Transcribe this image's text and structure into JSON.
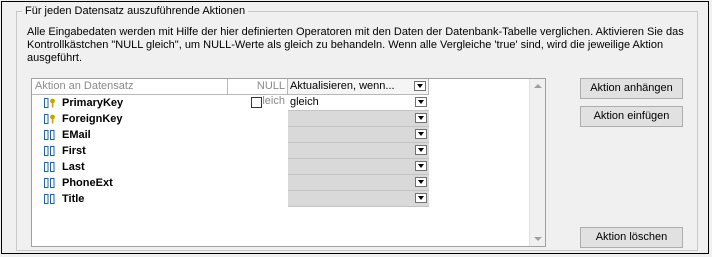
{
  "group": {
    "title": "Für jeden Datensatz auszuführende Aktionen",
    "description": "Alle Eingabedaten werden mit Hilfe der hier definierten Operatoren mit den Daten der Datenbank-Tabelle verglichen. Aktivieren Sie das Kontrollkästchen \"NULL gleich\", um NULL-Werte als gleich zu behandeln. Wenn alle Vergleiche 'true' sind, wird die jeweilige Aktion ausgeführt."
  },
  "grid": {
    "headers": {
      "action": "Aktion an Datensatz",
      "null_equal": "NULL gleich",
      "update": "Aktualisieren, wenn..."
    },
    "rows": [
      {
        "name": "PrimaryKey",
        "icon": "key-column-icon",
        "null_checkbox": true,
        "null_checked": false,
        "operator": "gleich"
      },
      {
        "name": "ForeignKey",
        "icon": "key-column-icon",
        "null_checkbox": false,
        "operator": ""
      },
      {
        "name": "EMail",
        "icon": "column-icon",
        "null_checkbox": false,
        "operator": ""
      },
      {
        "name": "First",
        "icon": "column-icon",
        "null_checkbox": false,
        "operator": ""
      },
      {
        "name": "Last",
        "icon": "column-icon",
        "null_checkbox": false,
        "operator": ""
      },
      {
        "name": "PhoneExt",
        "icon": "column-icon",
        "null_checkbox": false,
        "operator": ""
      },
      {
        "name": "Title",
        "icon": "column-icon",
        "null_checkbox": false,
        "operator": ""
      }
    ]
  },
  "buttons": {
    "append": "Aktion anhängen",
    "insert": "Aktion einfügen",
    "delete": "Aktion löschen"
  },
  "colors": {
    "operator_cell": "#d9d9d9",
    "key_icon": "#c8a400",
    "column_icon": "#2060b0"
  }
}
